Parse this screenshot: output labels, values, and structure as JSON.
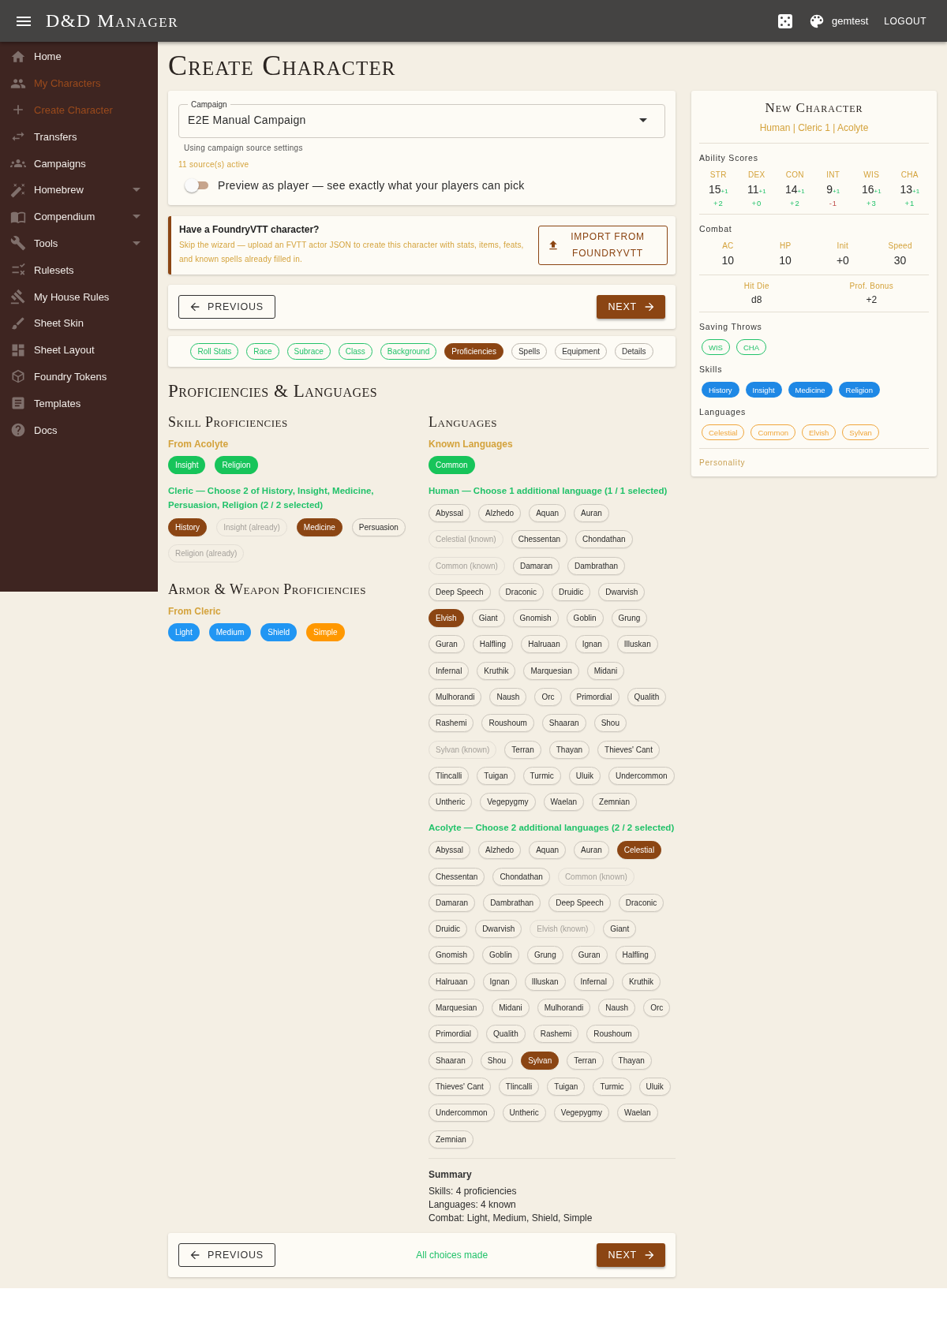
{
  "app_bar": {
    "title": "D&D Manager",
    "user": "gemtest",
    "logout": "LOGOUT"
  },
  "sidebar": {
    "items": [
      {
        "label": "Home",
        "selected": false,
        "expandable": false
      },
      {
        "label": "My Characters",
        "selected": true,
        "expandable": false
      },
      {
        "label": "Create Character",
        "selected": true,
        "expandable": false
      },
      {
        "label": "Transfers",
        "selected": false,
        "expandable": false
      },
      {
        "label": "Campaigns",
        "selected": false,
        "expandable": false
      },
      {
        "label": "Homebrew",
        "selected": false,
        "expandable": true
      },
      {
        "label": "Compendium",
        "selected": false,
        "expandable": true
      },
      {
        "label": "Tools",
        "selected": false,
        "expandable": true
      },
      {
        "label": "Rulesets",
        "selected": false,
        "expandable": false
      },
      {
        "label": "My House Rules",
        "selected": false,
        "expandable": false
      },
      {
        "label": "Sheet Skin",
        "selected": false,
        "expandable": false
      },
      {
        "label": "Sheet Layout",
        "selected": false,
        "expandable": false
      },
      {
        "label": "Foundry Tokens",
        "selected": false,
        "expandable": false
      },
      {
        "label": "Templates",
        "selected": false,
        "expandable": false
      },
      {
        "label": "Docs",
        "selected": false,
        "expandable": false
      }
    ]
  },
  "page_title": "Create Character",
  "campaign": {
    "label": "Campaign",
    "value": "E2E Manual Campaign",
    "helper": "Using campaign source settings",
    "sources": "11 source(s) active",
    "preview": {
      "label": "Preview as player — see exactly what your players can pick",
      "on": false
    }
  },
  "foundry": {
    "title": "Have a FoundryVTT character?",
    "description": "Skip the wizard — upload an FVTT actor JSON to create this character with stats, items, feats, and known spells already filled in.",
    "button": "IMPORT FROM FOUNDRYVTT"
  },
  "nav": {
    "previous": "PREVIOUS",
    "next": "NEXT"
  },
  "steps": [
    {
      "label": "Roll Stats",
      "done": true,
      "selected": false
    },
    {
      "label": "Race",
      "done": true,
      "selected": false
    },
    {
      "label": "Subrace",
      "done": true,
      "selected": false
    },
    {
      "label": "Class",
      "done": true,
      "selected": false
    },
    {
      "label": "Background",
      "done": true,
      "selected": false
    },
    {
      "label": "Proficiencies",
      "done": false,
      "selected": true
    },
    {
      "label": "Spells",
      "done": false,
      "selected": false
    },
    {
      "label": "Equipment",
      "done": false,
      "selected": false
    },
    {
      "label": "Details",
      "done": false,
      "selected": false
    }
  ],
  "section_title": "Proficiencies & Languages",
  "skills": {
    "title": "Skill Proficiencies",
    "fixed_label": "From Acolyte",
    "fixed": [
      "Insight",
      "Religion"
    ],
    "choice_label": "Cleric — Choose 2 of History, Insight, Medicine, Persuasion, Religion (2 / 2 selected)",
    "choices": [
      {
        "label": "History",
        "selected": true,
        "disabled": false
      },
      {
        "label": "Insight (already)",
        "selected": false,
        "disabled": true
      },
      {
        "label": "Medicine",
        "selected": true,
        "disabled": false
      },
      {
        "label": "Persuasion",
        "selected": false,
        "disabled": false
      },
      {
        "label": "Religion (already)",
        "selected": false,
        "disabled": true
      }
    ]
  },
  "armor": {
    "title": "Armor & Weapon Proficiencies",
    "label": "From Cleric",
    "items": [
      {
        "label": "Light",
        "color": "#2196f3"
      },
      {
        "label": "Medium",
        "color": "#2196f3"
      },
      {
        "label": "Shield",
        "color": "#2196f3"
      },
      {
        "label": "Simple",
        "color": "#ff9800"
      }
    ]
  },
  "languages": {
    "title": "Languages",
    "known_label": "Known Languages",
    "known": [
      "Common"
    ],
    "groups": [
      {
        "label": "Human — Choose 1 additional language (1 / 1 selected)",
        "options": [
          {
            "label": "Abyssal",
            "selected": false,
            "disabled": false
          },
          {
            "label": "Alzhedo",
            "selected": false,
            "disabled": false
          },
          {
            "label": "Aquan",
            "selected": false,
            "disabled": false
          },
          {
            "label": "Auran",
            "selected": false,
            "disabled": false
          },
          {
            "label": "Celestial (known)",
            "selected": false,
            "disabled": true
          },
          {
            "label": "Chessentan",
            "selected": false,
            "disabled": false
          },
          {
            "label": "Chondathan",
            "selected": false,
            "disabled": false
          },
          {
            "label": "Common (known)",
            "selected": false,
            "disabled": true
          },
          {
            "label": "Damaran",
            "selected": false,
            "disabled": false
          },
          {
            "label": "Dambrathan",
            "selected": false,
            "disabled": false
          },
          {
            "label": "Deep Speech",
            "selected": false,
            "disabled": false
          },
          {
            "label": "Draconic",
            "selected": false,
            "disabled": false
          },
          {
            "label": "Druidic",
            "selected": false,
            "disabled": false
          },
          {
            "label": "Dwarvish",
            "selected": false,
            "disabled": false
          },
          {
            "label": "Elvish",
            "selected": true,
            "disabled": false
          },
          {
            "label": "Giant",
            "selected": false,
            "disabled": false
          },
          {
            "label": "Gnomish",
            "selected": false,
            "disabled": false
          },
          {
            "label": "Goblin",
            "selected": false,
            "disabled": false
          },
          {
            "label": "Grung",
            "selected": false,
            "disabled": false
          },
          {
            "label": "Guran",
            "selected": false,
            "disabled": false
          },
          {
            "label": "Halfling",
            "selected": false,
            "disabled": false
          },
          {
            "label": "Halruaan",
            "selected": false,
            "disabled": false
          },
          {
            "label": "Ignan",
            "selected": false,
            "disabled": false
          },
          {
            "label": "Illuskan",
            "selected": false,
            "disabled": false
          },
          {
            "label": "Infernal",
            "selected": false,
            "disabled": false
          },
          {
            "label": "Kruthik",
            "selected": false,
            "disabled": false
          },
          {
            "label": "Marquesian",
            "selected": false,
            "disabled": false
          },
          {
            "label": "Midani",
            "selected": false,
            "disabled": false
          },
          {
            "label": "Mulhorandi",
            "selected": false,
            "disabled": false
          },
          {
            "label": "Naush",
            "selected": false,
            "disabled": false
          },
          {
            "label": "Orc",
            "selected": false,
            "disabled": false
          },
          {
            "label": "Primordial",
            "selected": false,
            "disabled": false
          },
          {
            "label": "Qualith",
            "selected": false,
            "disabled": false
          },
          {
            "label": "Rashemi",
            "selected": false,
            "disabled": false
          },
          {
            "label": "Roushoum",
            "selected": false,
            "disabled": false
          },
          {
            "label": "Shaaran",
            "selected": false,
            "disabled": false
          },
          {
            "label": "Shou",
            "selected": false,
            "disabled": false
          },
          {
            "label": "Sylvan (known)",
            "selected": false,
            "disabled": true
          },
          {
            "label": "Terran",
            "selected": false,
            "disabled": false
          },
          {
            "label": "Thayan",
            "selected": false,
            "disabled": false
          },
          {
            "label": "Thieves' Cant",
            "selected": false,
            "disabled": false
          },
          {
            "label": "Tlincalli",
            "selected": false,
            "disabled": false
          },
          {
            "label": "Tuigan",
            "selected": false,
            "disabled": false
          },
          {
            "label": "Turmic",
            "selected": false,
            "disabled": false
          },
          {
            "label": "Uluik",
            "selected": false,
            "disabled": false
          },
          {
            "label": "Undercommon",
            "selected": false,
            "disabled": false
          },
          {
            "label": "Untheric",
            "selected": false,
            "disabled": false
          },
          {
            "label": "Vegepygmy",
            "selected": false,
            "disabled": false
          },
          {
            "label": "Waelan",
            "selected": false,
            "disabled": false
          },
          {
            "label": "Zemnian",
            "selected": false,
            "disabled": false
          }
        ]
      },
      {
        "label": "Acolyte — Choose 2 additional languages (2 / 2 selected)",
        "options": [
          {
            "label": "Abyssal",
            "selected": false,
            "disabled": false
          },
          {
            "label": "Alzhedo",
            "selected": false,
            "disabled": false
          },
          {
            "label": "Aquan",
            "selected": false,
            "disabled": false
          },
          {
            "label": "Auran",
            "selected": false,
            "disabled": false
          },
          {
            "label": "Celestial",
            "selected": true,
            "disabled": false
          },
          {
            "label": "Chessentan",
            "selected": false,
            "disabled": false
          },
          {
            "label": "Chondathan",
            "selected": false,
            "disabled": false
          },
          {
            "label": "Common (known)",
            "selected": false,
            "disabled": true
          },
          {
            "label": "Damaran",
            "selected": false,
            "disabled": false
          },
          {
            "label": "Dambrathan",
            "selected": false,
            "disabled": false
          },
          {
            "label": "Deep Speech",
            "selected": false,
            "disabled": false
          },
          {
            "label": "Draconic",
            "selected": false,
            "disabled": false
          },
          {
            "label": "Druidic",
            "selected": false,
            "disabled": false
          },
          {
            "label": "Dwarvish",
            "selected": false,
            "disabled": false
          },
          {
            "label": "Elvish (known)",
            "selected": false,
            "disabled": true
          },
          {
            "label": "Giant",
            "selected": false,
            "disabled": false
          },
          {
            "label": "Gnomish",
            "selected": false,
            "disabled": false
          },
          {
            "label": "Goblin",
            "selected": false,
            "disabled": false
          },
          {
            "label": "Grung",
            "selected": false,
            "disabled": false
          },
          {
            "label": "Guran",
            "selected": false,
            "disabled": false
          },
          {
            "label": "Halfling",
            "selected": false,
            "disabled": false
          },
          {
            "label": "Halruaan",
            "selected": false,
            "disabled": false
          },
          {
            "label": "Ignan",
            "selected": false,
            "disabled": false
          },
          {
            "label": "Illuskan",
            "selected": false,
            "disabled": false
          },
          {
            "label": "Infernal",
            "selected": false,
            "disabled": false
          },
          {
            "label": "Kruthik",
            "selected": false,
            "disabled": false
          },
          {
            "label": "Marquesian",
            "selected": false,
            "disabled": false
          },
          {
            "label": "Midani",
            "selected": false,
            "disabled": false
          },
          {
            "label": "Mulhorandi",
            "selected": false,
            "disabled": false
          },
          {
            "label": "Naush",
            "selected": false,
            "disabled": false
          },
          {
            "label": "Orc",
            "selected": false,
            "disabled": false
          },
          {
            "label": "Primordial",
            "selected": false,
            "disabled": false
          },
          {
            "label": "Qualith",
            "selected": false,
            "disabled": false
          },
          {
            "label": "Rashemi",
            "selected": false,
            "disabled": false
          },
          {
            "label": "Roushoum",
            "selected": false,
            "disabled": false
          },
          {
            "label": "Shaaran",
            "selected": false,
            "disabled": false
          },
          {
            "label": "Shou",
            "selected": false,
            "disabled": false
          },
          {
            "label": "Sylvan",
            "selected": true,
            "disabled": false
          },
          {
            "label": "Terran",
            "selected": false,
            "disabled": false
          },
          {
            "label": "Thayan",
            "selected": false,
            "disabled": false
          },
          {
            "label": "Thieves' Cant",
            "selected": false,
            "disabled": false
          },
          {
            "label": "Tlincalli",
            "selected": false,
            "disabled": false
          },
          {
            "label": "Tuigan",
            "selected": false,
            "disabled": false
          },
          {
            "label": "Turmic",
            "selected": false,
            "disabled": false
          },
          {
            "label": "Uluik",
            "selected": false,
            "disabled": false
          },
          {
            "label": "Undercommon",
            "selected": false,
            "disabled": false
          },
          {
            "label": "Untheric",
            "selected": false,
            "disabled": false
          },
          {
            "label": "Vegepygmy",
            "selected": false,
            "disabled": false
          },
          {
            "label": "Waelan",
            "selected": false,
            "disabled": false
          },
          {
            "label": "Zemnian",
            "selected": false,
            "disabled": false
          }
        ]
      }
    ]
  },
  "summary": {
    "title": "Summary",
    "lines": [
      "Skills: 4 proficiencies",
      "Languages: 4 known",
      "Combat: Light, Medium, Shield, Simple"
    ]
  },
  "footer": {
    "previous": "PREVIOUS",
    "status": "All choices made",
    "next": "NEXT"
  },
  "preview_card": {
    "title": "New Character",
    "subtitle": "Human | Cleric 1 | Acolyte",
    "abilities_label": "Ability Scores",
    "abilities": [
      {
        "name": "STR",
        "score": "15",
        "bonus": "+1",
        "modifier": "+2",
        "negative": false
      },
      {
        "name": "DEX",
        "score": "11",
        "bonus": "+1",
        "modifier": "+0",
        "negative": false
      },
      {
        "name": "CON",
        "score": "14",
        "bonus": "+1",
        "modifier": "+2",
        "negative": false
      },
      {
        "name": "INT",
        "score": "9",
        "bonus": "+1",
        "modifier": "-1",
        "negative": true
      },
      {
        "name": "WIS",
        "score": "16",
        "bonus": "+1",
        "modifier": "+3",
        "negative": false
      },
      {
        "name": "CHA",
        "score": "13",
        "bonus": "+1",
        "modifier": "+1",
        "negative": false
      }
    ],
    "combat_label": "Combat",
    "combat": [
      {
        "label": "AC",
        "value": "10"
      },
      {
        "label": "HP",
        "value": "10"
      },
      {
        "label": "Init",
        "value": "+0"
      },
      {
        "label": "Speed",
        "value": "30"
      }
    ],
    "extra": [
      {
        "label": "Hit Die",
        "value": "d8"
      },
      {
        "label": "Prof. Bonus",
        "value": "+2"
      }
    ],
    "saves_label": "Saving Throws",
    "saves": [
      "WIS",
      "CHA"
    ],
    "skills_label": "Skills",
    "skills": [
      "History",
      "Insight",
      "Medicine",
      "Religion"
    ],
    "languages_label": "Languages",
    "languages": [
      "Celestial",
      "Common",
      "Elvish",
      "Sylvan"
    ],
    "personality": "Personality"
  }
}
